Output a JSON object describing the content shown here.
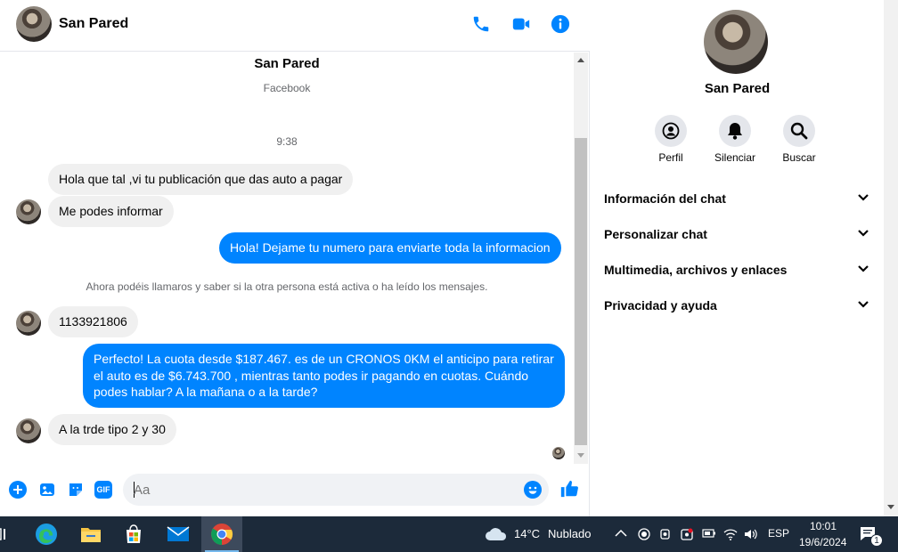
{
  "header": {
    "contact_name": "San Pared"
  },
  "conversation": {
    "contact_name": "San Pared",
    "source": "Facebook",
    "timestamp": "9:38",
    "notice": "Ahora podéis llamaros y saber si la otra persona está activa o ha leído los mensajes.",
    "messages": [
      {
        "dir": "in",
        "text": "Hola que tal ,vi tu publicación que das auto a pagar"
      },
      {
        "dir": "in",
        "text": "Me podes informar"
      },
      {
        "dir": "out",
        "text": "Hola! Dejame tu numero  para enviarte toda la informacion"
      },
      {
        "dir": "in",
        "text": "1133921806"
      },
      {
        "dir": "out",
        "text": "Perfecto! La cuota desde $187.467. es de un CRONOS 0KM el anticipo para retirar el auto es de $6.743.700 , mientras tanto podes ir pagando en cuotas. Cuándo podes hablar? A la mañana o a la tarde?"
      },
      {
        "dir": "in",
        "text": "A la trde tipo 2 y 30"
      }
    ]
  },
  "composer": {
    "placeholder": "Aa",
    "gif_label": "GIF"
  },
  "sidebar": {
    "contact_name": "San Pared",
    "actions": [
      {
        "label": "Perfil",
        "icon": "profile-icon"
      },
      {
        "label": "Silenciar",
        "icon": "bell-icon"
      },
      {
        "label": "Buscar",
        "icon": "search-icon"
      }
    ],
    "sections": [
      {
        "label": "Información del chat"
      },
      {
        "label": "Personalizar chat"
      },
      {
        "label": "Multimedia, archivos y enlaces"
      },
      {
        "label": "Privacidad y ayuda"
      }
    ]
  },
  "taskbar": {
    "weather_temp": "14°C",
    "weather_desc": "Nublado",
    "language": "ESP",
    "time": "10:01",
    "date": "19/6/2024",
    "notification_count": "1"
  },
  "colors": {
    "accent": "#0084ff",
    "incoming_bubble": "#f0f0f0",
    "taskbar": "#1c2a3a"
  }
}
